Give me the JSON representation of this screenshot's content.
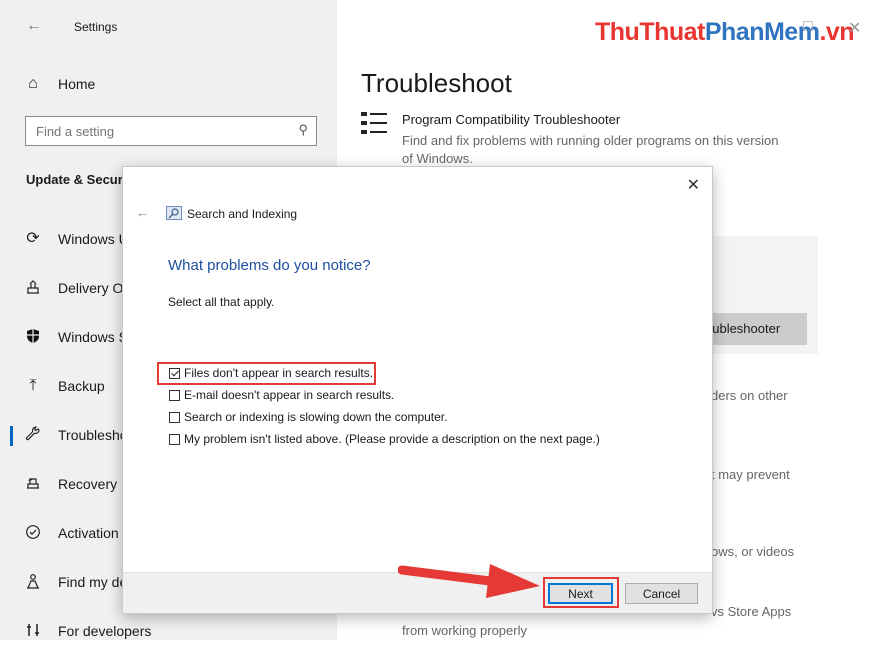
{
  "window": {
    "title": "Settings",
    "minimize_glyph": "—",
    "maximize_glyph": "□",
    "close_glyph": "✕"
  },
  "brand": {
    "part1": "ThuThuat",
    "part2": "PhanMem",
    "part3": ".vn",
    "colors": {
      "red": "#e8352f",
      "blue": "#2f74c0"
    }
  },
  "sidebar": {
    "home_label": "Home",
    "search": {
      "placeholder": "Find a setting",
      "icon": "search-icon"
    },
    "section_title": "Update & Secur",
    "items": [
      {
        "label": "Windows U",
        "icon": "sync-icon"
      },
      {
        "label": "Delivery Op",
        "icon": "delivery-icon"
      },
      {
        "label": "Windows S",
        "icon": "shield-icon"
      },
      {
        "label": "Backup",
        "icon": "upload-icon"
      },
      {
        "label": "Troublesho",
        "icon": "wrench-icon",
        "active": true
      },
      {
        "label": "Recovery",
        "icon": "recovery-icon"
      },
      {
        "label": "Activation",
        "icon": "check-circle-icon"
      },
      {
        "label": "Find my de",
        "icon": "person-location-icon"
      },
      {
        "label": "For developers",
        "icon": "developer-icon"
      }
    ]
  },
  "main": {
    "page_title": "Troubleshoot",
    "troubleshooter": {
      "title": "Program Compatibility Troubleshooter",
      "description": "Find and fix problems with running older programs on this version of Windows."
    },
    "button_fragment": "oubleshooter",
    "fragments": [
      "ders on other",
      "t may prevent",
      "ows, or videos",
      "vs Store Apps",
      "from working properly"
    ]
  },
  "dialog": {
    "app_title": "Search and Indexing",
    "heading": "What problems do you notice?",
    "subheading": "Select all that apply.",
    "options": [
      {
        "label": "Files don't appear in search results.",
        "checked": true
      },
      {
        "label": "E-mail doesn't appear in search results.",
        "checked": false
      },
      {
        "label": "Search or indexing is slowing down the computer.",
        "checked": false
      },
      {
        "label": "My problem isn't listed above. (Please provide a description on the next page.)",
        "checked": false
      }
    ],
    "next_label": "Next",
    "cancel_label": "Cancel",
    "highlight_color": "#e53935",
    "heading_color": "#1e4fa0"
  }
}
